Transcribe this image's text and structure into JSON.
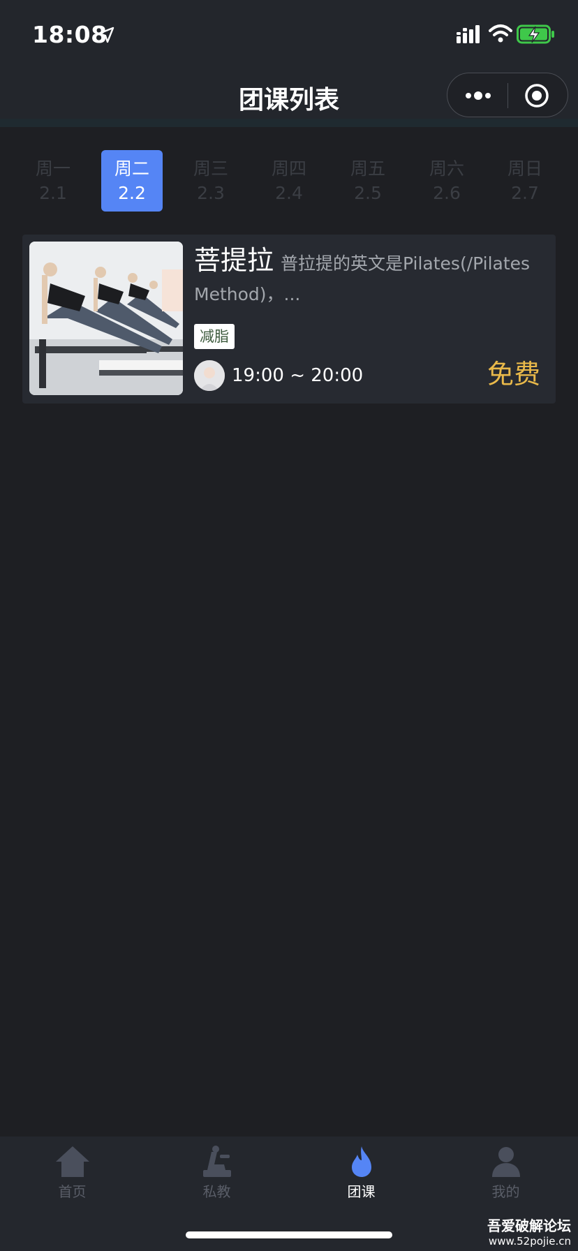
{
  "status_bar": {
    "time": "18:08",
    "icons": [
      "location-arrow-icon",
      "signal-icon",
      "wifi-icon",
      "battery-charging-icon"
    ],
    "battery_color": "#3fc84a"
  },
  "title_bar": {
    "title": "团课列表",
    "capsule_icons": [
      "more-icon",
      "target-icon"
    ]
  },
  "days": [
    {
      "weekday": "周一",
      "date": "2.1",
      "active": false
    },
    {
      "weekday": "周二",
      "date": "2.2",
      "active": true
    },
    {
      "weekday": "周三",
      "date": "2.3",
      "active": false
    },
    {
      "weekday": "周四",
      "date": "2.4",
      "active": false
    },
    {
      "weekday": "周五",
      "date": "2.5",
      "active": false
    },
    {
      "weekday": "周六",
      "date": "2.6",
      "active": false
    },
    {
      "weekday": "周日",
      "date": "2.7",
      "active": false
    }
  ],
  "course": {
    "name": "菩提拉",
    "description": "普拉提的英文是Pilates(/Pilates Method)，...",
    "tag": "减脂",
    "time": "19:00 ~ 20:00",
    "price": "免费",
    "price_color": "#e9b94a"
  },
  "tab_bar": {
    "items": [
      {
        "label": "首页",
        "icon": "home-icon",
        "active": false
      },
      {
        "label": "私教",
        "icon": "private-coach-icon",
        "active": false
      },
      {
        "label": "团课",
        "icon": "flame-icon",
        "active": true
      },
      {
        "label": "我的",
        "icon": "user-icon",
        "active": false
      }
    ],
    "active_color": "#5585f5"
  },
  "watermark": {
    "title": "吾爱破解论坛",
    "url": "www.52pojie.cn"
  },
  "colors": {
    "accent": "#5585f5",
    "background": "#1e1f23",
    "card": "#272a31"
  }
}
